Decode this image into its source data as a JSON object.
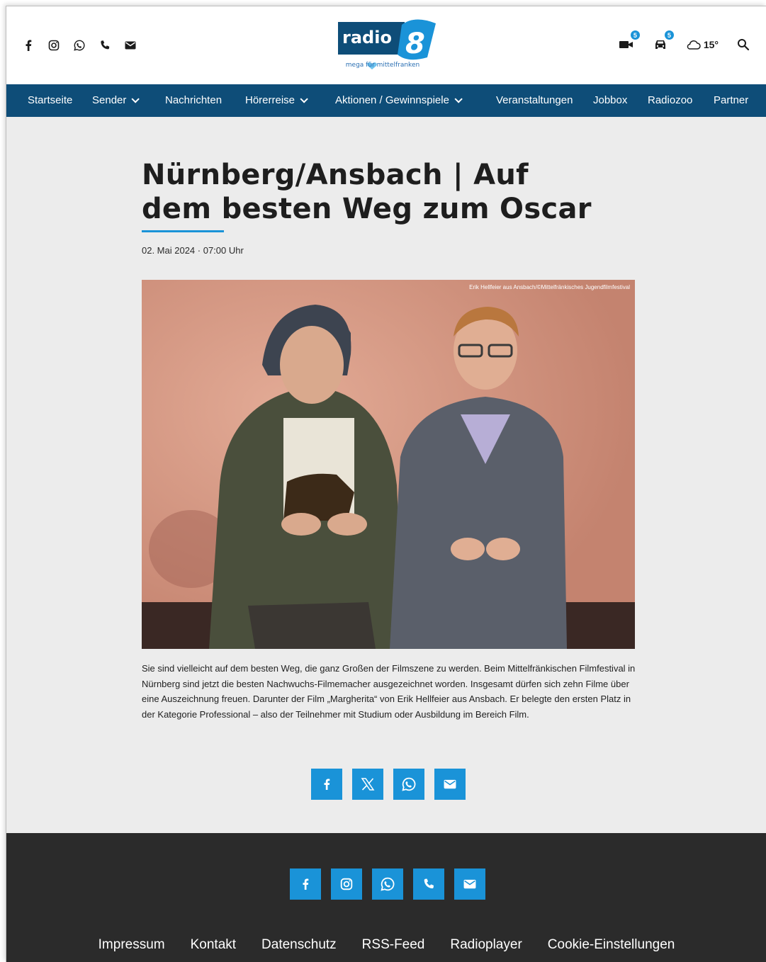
{
  "header": {
    "social_icons": [
      "facebook-icon",
      "instagram-icon",
      "whatsapp-icon",
      "phone-icon",
      "mail-icon"
    ],
    "logo": {
      "brand": "radio",
      "number": "8",
      "tagline": "mega für mittelfranken"
    },
    "traffic_camera_count": "5",
    "traffic_count": "5",
    "weather_temp": "15°"
  },
  "nav": {
    "items": [
      {
        "label": "Startseite",
        "has_dropdown": false
      },
      {
        "label": "Sender",
        "has_dropdown": true
      },
      {
        "label": "Nachrichten",
        "has_dropdown": false
      },
      {
        "label": "Hörerreise",
        "has_dropdown": true
      },
      {
        "label": "Aktionen / Gewinnspiele",
        "has_dropdown": true
      },
      {
        "label": "Veranstaltungen",
        "has_dropdown": false
      },
      {
        "label": "Jobbox",
        "has_dropdown": false
      },
      {
        "label": "Radiozoo",
        "has_dropdown": false
      },
      {
        "label": "Partner",
        "has_dropdown": false
      }
    ]
  },
  "article": {
    "title": "Nürnberg/Ansbach | Auf dem besten Weg zum Oscar",
    "date": "02. Mai 2024 · 07:00 Uhr",
    "photo_credit": "Erik Hellfeier aus Ansbach/©Mittelfränkisches Jugendfilmfestival",
    "body": "Sie sind vielleicht auf dem besten Weg, die ganz Großen der Filmszene zu werden. Beim Mittelfränkischen Filmfestival in Nürnberg sind jetzt die besten Nachwuchs-Filmemacher ausgezeichnet worden. Insgesamt dürfen sich zehn Filme über eine Auszeichnung freuen. Darunter der Film „Margherita“ von Erik Hellfeier aus Ansbach. Er belegte den ersten Platz in der Kategorie Professional – also der Teilnehmer mit Studium oder Ausbildung im Bereich Film.",
    "share_icons": [
      "facebook-icon",
      "x-icon",
      "whatsapp-icon",
      "mail-icon"
    ]
  },
  "footer": {
    "social_icons": [
      "facebook-icon",
      "instagram-icon",
      "whatsapp-icon",
      "phone-icon",
      "mail-icon"
    ],
    "links": [
      "Impressum",
      "Kontakt",
      "Datenschutz",
      "RSS-Feed",
      "Radioplayer",
      "Cookie-Einstellungen"
    ]
  },
  "colors": {
    "nav_bg": "#0e4d78",
    "accent": "#1a93d8",
    "page_bg": "#ececec",
    "footer_bg": "#2b2b2b"
  }
}
